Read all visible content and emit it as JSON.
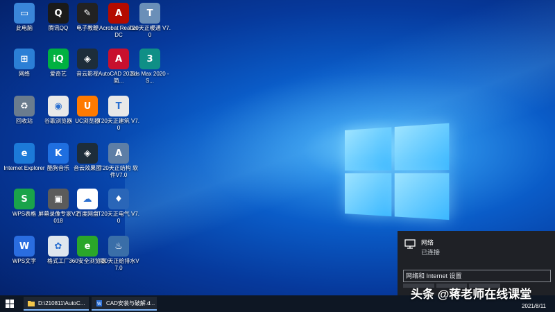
{
  "desktop": {
    "icons": [
      {
        "label": "此电脑",
        "color": "#3a86d8",
        "glyph": "▭",
        "icon": "computer-icon"
      },
      {
        "label": "腾讯QQ",
        "color": "#1a1a1a",
        "glyph": "Q",
        "icon": "qq-icon"
      },
      {
        "label": "电子教鞭",
        "color": "#222222",
        "glyph": "✎",
        "icon": "pointer-icon"
      },
      {
        "label": "Acrobat Reader DC",
        "color": "#b30b00",
        "glyph": "A",
        "icon": "acrobat-icon"
      },
      {
        "label": "T20天正暖通 V7.0",
        "color": "#6a8fb8",
        "glyph": "T",
        "icon": "tangent-hvac-icon"
      },
      {
        "label": "网络",
        "color": "#2b7fd6",
        "glyph": "⊞",
        "icon": "network-icon"
      },
      {
        "label": "爱奇艺",
        "color": "#00b140",
        "glyph": "iQ",
        "icon": "iqiyi-icon"
      },
      {
        "label": "音云影视",
        "color": "#1d2d3a",
        "glyph": "◈",
        "icon": "yinyun-video-icon"
      },
      {
        "label": "AutoCAD 2020 - 简...",
        "color": "#c8102e",
        "glyph": "A",
        "icon": "autocad-icon"
      },
      {
        "label": "3ds Max 2020 - S...",
        "color": "#0f8f86",
        "glyph": "3",
        "icon": "3dsmax-icon"
      },
      {
        "label": "回收站",
        "color": "#6a7c8e",
        "glyph": "♻",
        "icon": "recycle-bin-icon"
      },
      {
        "label": "谷歌浏览器",
        "color": "#e9e9e9",
        "glyph": "◉",
        "icon": "chrome-icon"
      },
      {
        "label": "UC浏览器",
        "color": "#ff7a00",
        "glyph": "U",
        "icon": "uc-browser-icon"
      },
      {
        "label": "T20天正建筑 V7.0",
        "color": "#e8e8e8",
        "glyph": "T",
        "icon": "tangent-arch-icon"
      },
      {
        "label": "Internet Explorer",
        "color": "#1c7ad8",
        "glyph": "e",
        "icon": "ie-icon"
      },
      {
        "label": "酷狗音乐",
        "color": "#1f6fe0",
        "glyph": "K",
        "icon": "kugou-icon"
      },
      {
        "label": "音云效果图",
        "color": "#1d2d3a",
        "glyph": "◈",
        "icon": "yinyun-render-icon"
      },
      {
        "label": "T20天正结构 软件V7.0",
        "color": "#5d7ea6",
        "glyph": "A",
        "icon": "tangent-struct-icon"
      },
      {
        "label": "WPS表格",
        "color": "#1aa34a",
        "glyph": "S",
        "icon": "wps-sheet-icon"
      },
      {
        "label": "屏幕录像专家V2018",
        "color": "#5b5b5b",
        "glyph": "▣",
        "icon": "screen-recorder-icon"
      },
      {
        "label": "百度网盘",
        "color": "#ffffff",
        "glyph": "☁",
        "icon": "baidu-netdisk-icon"
      },
      {
        "label": "T20天正电气 V7.0",
        "color": "#2a66b8",
        "glyph": "♦",
        "icon": "tangent-elec-icon"
      },
      {
        "label": "WPS文字",
        "color": "#2a6de0",
        "glyph": "W",
        "icon": "wps-writer-icon"
      },
      {
        "label": "格式工厂",
        "color": "#dfe6ee",
        "glyph": "✿",
        "icon": "format-factory-icon"
      },
      {
        "label": "360安全浏览器",
        "color": "#2aa62a",
        "glyph": "e",
        "icon": "360-browser-icon"
      },
      {
        "label": "T20天正给排水V7.0",
        "color": "#3a6ea8",
        "glyph": "♨",
        "icon": "tangent-water-icon"
      }
    ]
  },
  "flyout": {
    "network_name": "网络",
    "network_status": "已连接",
    "settings_link": "网络和 Internet 设置"
  },
  "taskbar": {
    "tasks": [
      {
        "label": "D:\\210811\\AutoC...",
        "icon": "folder-icon"
      },
      {
        "label": "CAD安装与破解.d...",
        "icon": "document-icon"
      }
    ],
    "date": "2021/8/11"
  },
  "watermark": "头条 @蒋老师在线课堂"
}
